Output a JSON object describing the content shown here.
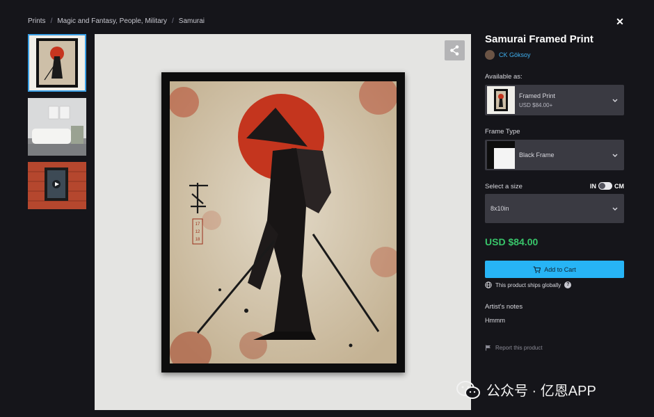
{
  "breadcrumb": {
    "items": [
      "Prints",
      "Magic and Fantasy, People, Military",
      "Samurai"
    ]
  },
  "product": {
    "title": "Samurai Framed Print",
    "artist": "CK Göksoy",
    "available_label": "Available as:",
    "available": {
      "name": "Framed Print",
      "price": "USD $84.00+"
    },
    "frame_label": "Frame Type",
    "frame_value": "Black Frame",
    "size_label": "Select a size",
    "unit_in": "IN",
    "unit_cm": "CM",
    "size_value": "8x10in",
    "price": "USD $84.00",
    "cart_label": "Add to Cart",
    "ships_label": "This product ships globally",
    "notes_title": "Artist's notes",
    "notes_text": "Hmmm",
    "report_label": "Report this product"
  },
  "artwork": {
    "date_mark": [
      "17",
      "12",
      "18"
    ]
  },
  "watermark": {
    "text": "公众号 · 亿恩APP"
  },
  "colors": {
    "accent": "#27b4f5",
    "price": "#38c56a",
    "link": "#3fb0f0",
    "background": "#15151a"
  },
  "icons": [
    "close-icon",
    "share-icon",
    "chevron-down-icon",
    "cart-icon",
    "globe-icon",
    "question-icon",
    "flag-icon",
    "play-icon",
    "wechat-icon"
  ]
}
